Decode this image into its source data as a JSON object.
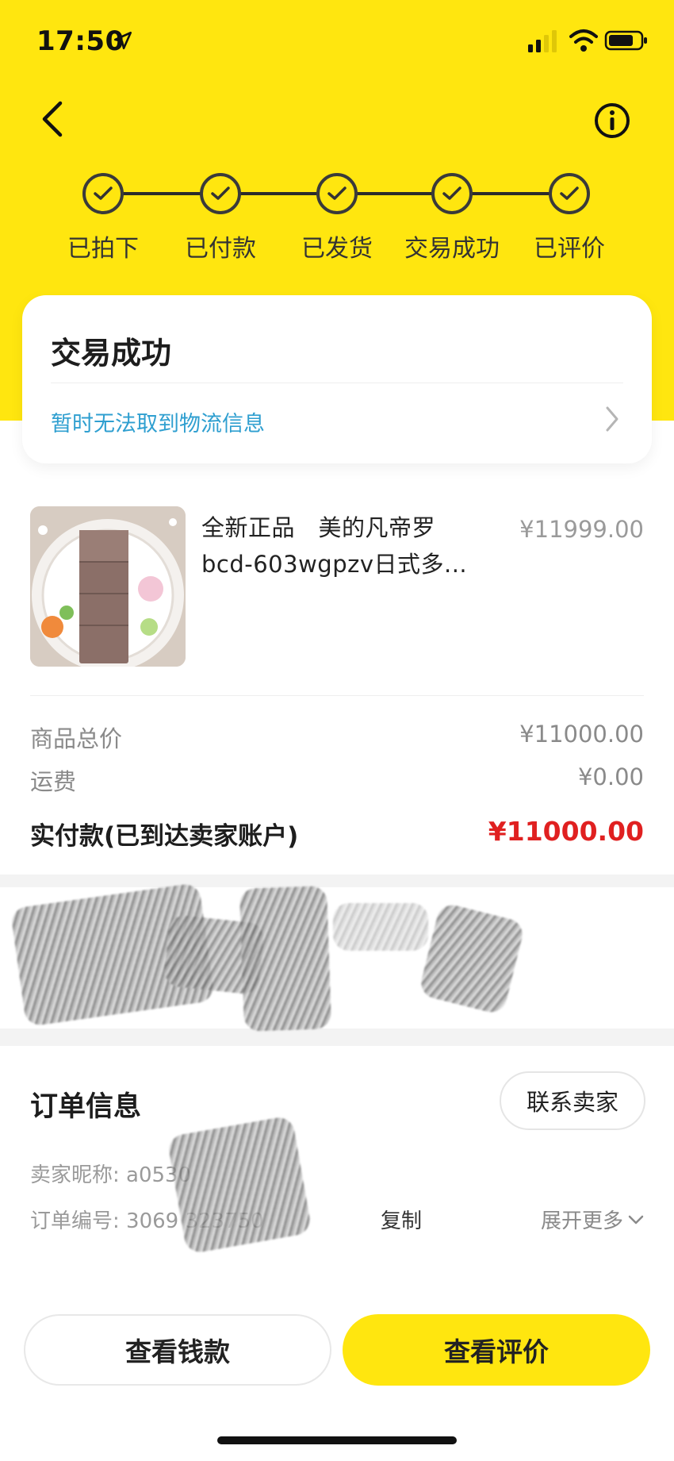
{
  "status_bar": {
    "time": "17:50"
  },
  "steps": [
    {
      "label": "已拍下"
    },
    {
      "label": "已付款"
    },
    {
      "label": "已发货"
    },
    {
      "label": "交易成功"
    },
    {
      "label": "已评价"
    }
  ],
  "status_card": {
    "title": "交易成功",
    "logistics": "暂时无法取到物流信息"
  },
  "product": {
    "title_line1": "全新正品　美的凡帝罗",
    "title_line2": "bcd-603wgpzv日式多...",
    "price": "¥11999.00"
  },
  "pricing": {
    "total_label": "商品总价",
    "total_value": "¥11000.00",
    "shipping_label": "运费",
    "shipping_value": "¥0.00",
    "paid_label": "实付款(已到达卖家账户)",
    "paid_value": "¥11000.00"
  },
  "order_info": {
    "title": "订单信息",
    "contact_seller": "联系卖家",
    "seller_nick": "卖家昵称: a0530",
    "order_no": "订单编号: 3069              323750",
    "copy": "复制",
    "expand_more": "展开更多"
  },
  "actions": {
    "view_wallet": "查看钱款",
    "view_review": "查看评价"
  },
  "colors": {
    "brand_yellow": "#FFE60F",
    "link_blue": "#2F9FD0",
    "price_red": "#E02020"
  }
}
